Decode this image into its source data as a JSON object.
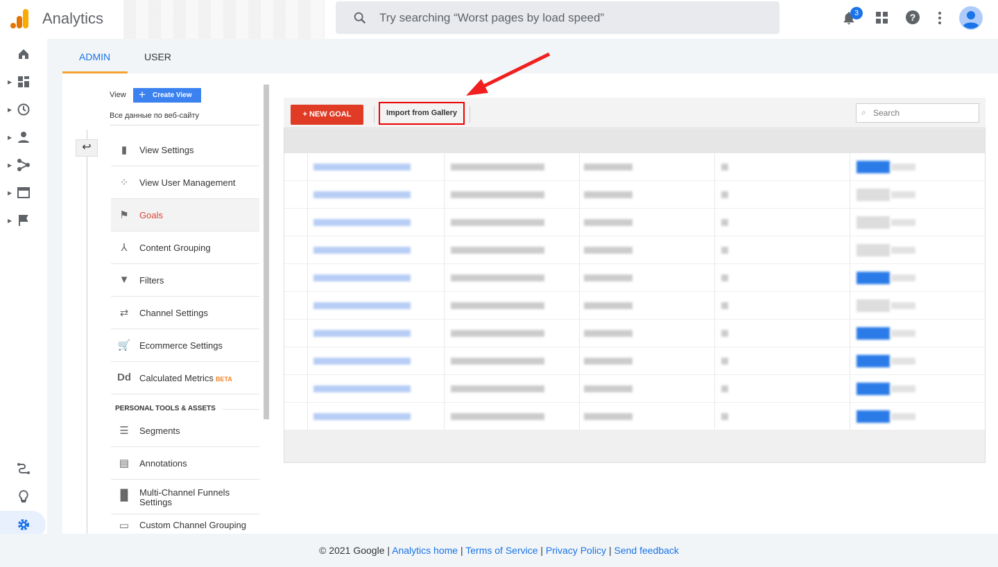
{
  "header": {
    "app_name": "Analytics",
    "search_placeholder": "Try searching “Worst pages by load speed”",
    "notification_count": "3"
  },
  "tabs": [
    {
      "label": "ADMIN",
      "active": true
    },
    {
      "label": "USER",
      "active": false
    }
  ],
  "view": {
    "label": "View",
    "create_button": "Create View",
    "view_name": "Все данные по веб-сайту"
  },
  "nav_items": [
    {
      "label": "View Settings",
      "icon": "document-icon"
    },
    {
      "label": "View User Management",
      "icon": "people-icon"
    },
    {
      "label": "Goals",
      "icon": "flag-icon",
      "active": true
    },
    {
      "label": "Content Grouping",
      "icon": "content-grouping-icon"
    },
    {
      "label": "Filters",
      "icon": "filter-icon"
    },
    {
      "label": "Channel Settings",
      "icon": "channel-settings-icon"
    },
    {
      "label": "Ecommerce Settings",
      "icon": "cart-icon"
    },
    {
      "label": "Calculated Metrics",
      "icon": "dd-icon",
      "badge": "BETA"
    }
  ],
  "personal_tools": {
    "heading": "PERSONAL TOOLS & ASSETS",
    "items": [
      {
        "label": "Segments",
        "icon": "segments-icon"
      },
      {
        "label": "Annotations",
        "icon": "annotation-icon"
      },
      {
        "label": "Multi-Channel Funnels Settings",
        "icon": "bar-chart-icon"
      },
      {
        "label": "Custom Channel Grouping",
        "icon": "channel-grouping-icon"
      }
    ]
  },
  "goals_toolbar": {
    "new_goal": "+ NEW GOAL",
    "import": "Import from Gallery",
    "search_placeholder": "Search"
  },
  "goals_table": {
    "rows_recording_on": [
      true,
      false,
      false,
      false,
      true,
      false,
      true,
      true,
      true,
      true
    ]
  },
  "colors": {
    "accent": "#1a73e8",
    "new_goal": "#e03b24",
    "highlight": "#ff0000",
    "active_nav": "#db4437"
  },
  "footer": {
    "copyright": "© 2021 Google",
    "links": [
      "Analytics home",
      "Terms of Service",
      "Privacy Policy",
      "Send feedback"
    ]
  }
}
